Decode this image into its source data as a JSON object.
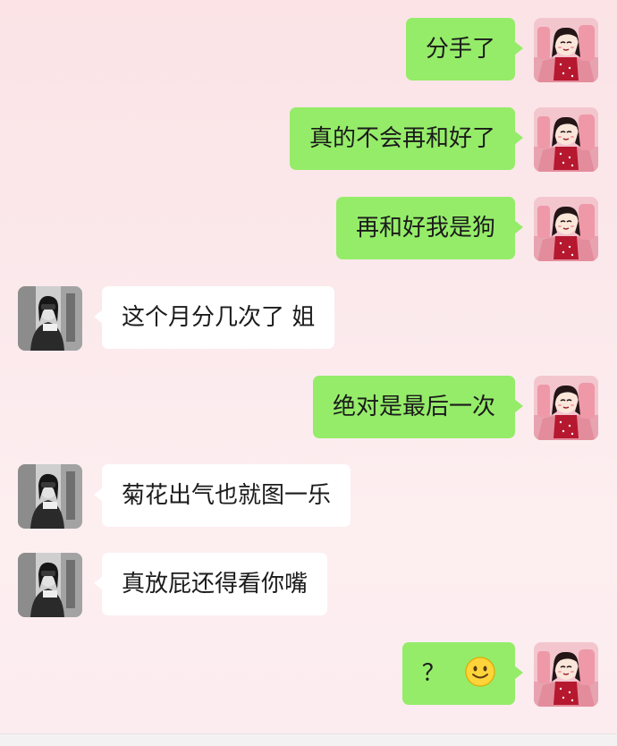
{
  "messages": [
    {
      "side": "out",
      "text": "分手了"
    },
    {
      "side": "out",
      "text": "真的不会再和好了"
    },
    {
      "side": "out",
      "text": "再和好我是狗"
    },
    {
      "side": "in",
      "text": "这个月分几次了 姐"
    },
    {
      "side": "out",
      "text": "绝对是最后一次"
    },
    {
      "side": "in",
      "text": "菊花出气也就图一乐"
    },
    {
      "side": "in",
      "text": "真放屁还得看你嘴"
    },
    {
      "side": "out",
      "text": "？",
      "emoji": "smile-emoji"
    }
  ],
  "colors": {
    "outgoing_bubble": "#95ec69",
    "incoming_bubble": "#ffffff",
    "background": "#fbe8eb"
  },
  "avatars": {
    "self": "cartoon-girl-avatar",
    "contact": "bw-photo-avatar"
  }
}
